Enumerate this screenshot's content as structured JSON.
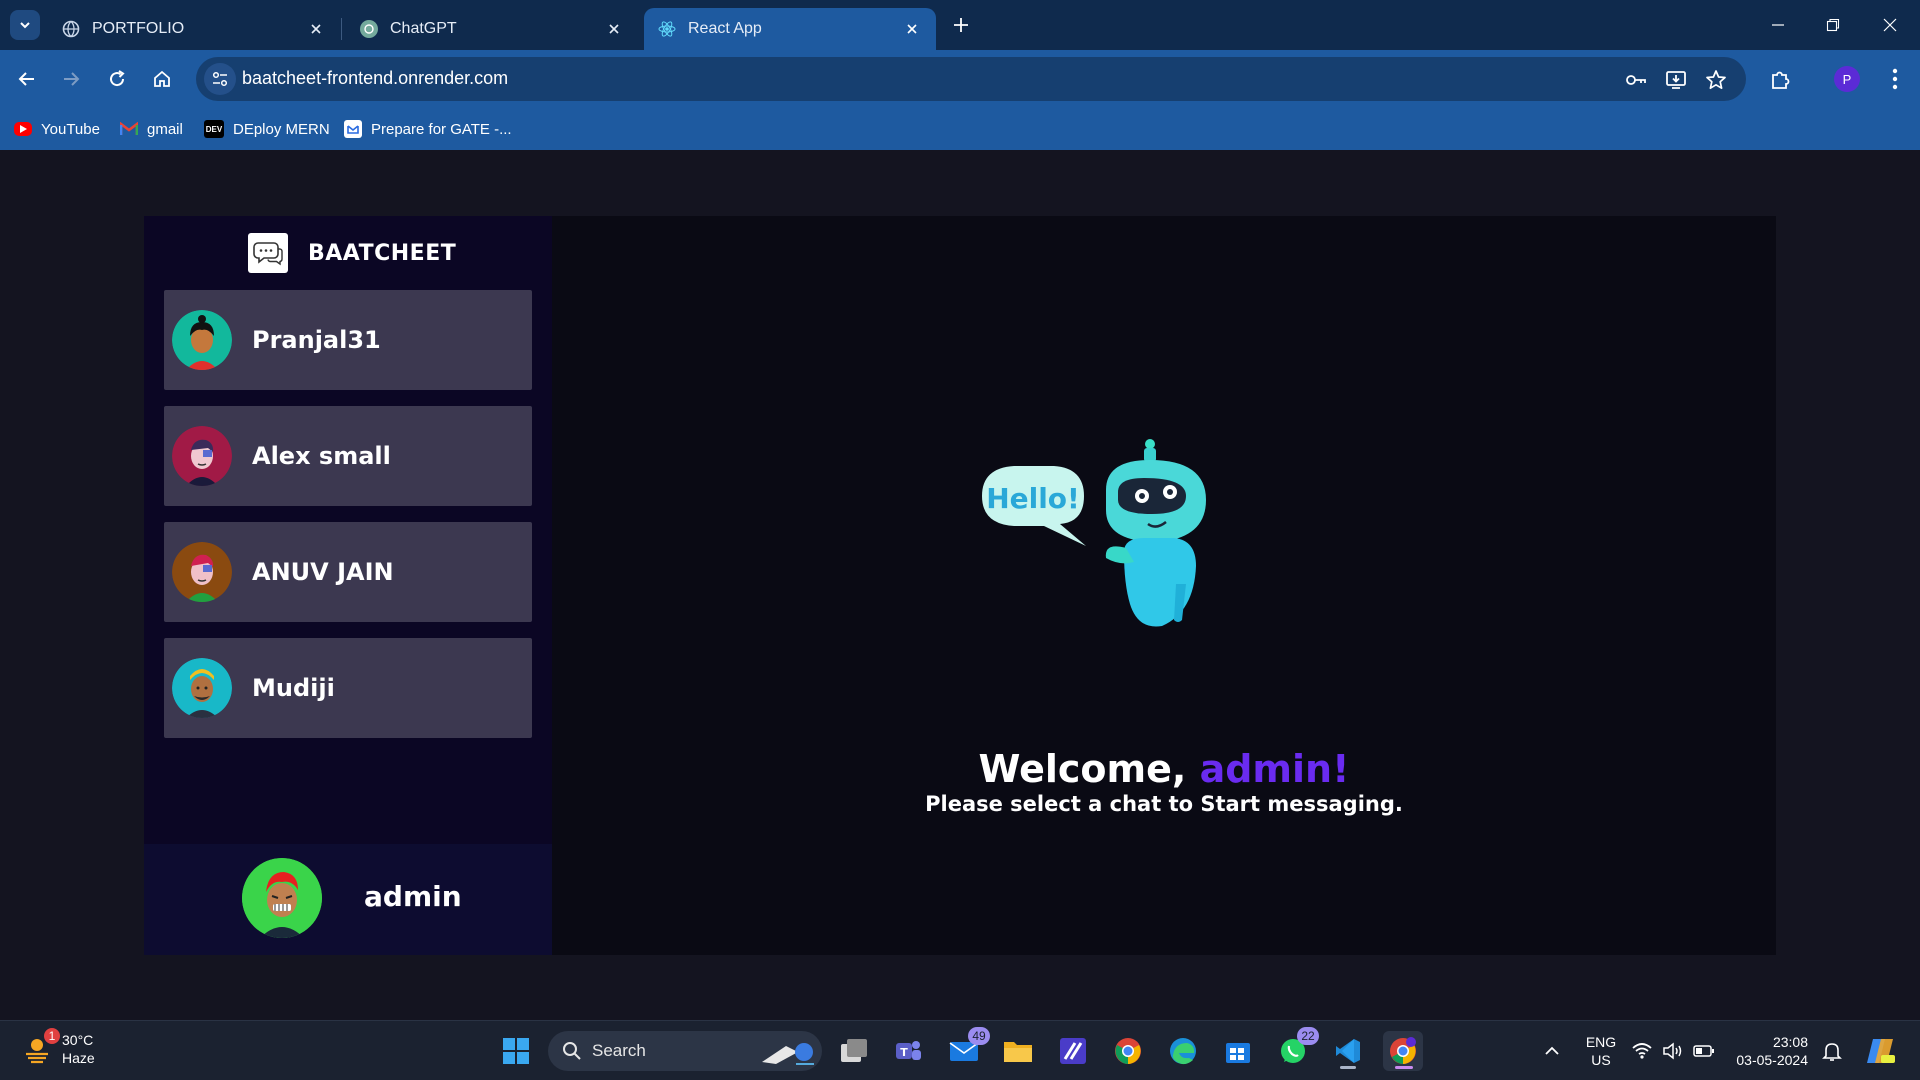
{
  "tabs": [
    {
      "title": "PORTFOLIO"
    },
    {
      "title": "ChatGPT"
    },
    {
      "title": "React App"
    }
  ],
  "address_bar": {
    "url": "baatcheet-frontend.onrender.com"
  },
  "profile_initial": "P",
  "bookmarks": [
    {
      "label": "YouTube"
    },
    {
      "label": "gmail"
    },
    {
      "label": "DEploy MERN"
    },
    {
      "label": "Prepare for GATE -..."
    }
  ],
  "app": {
    "brand": "BAATCHEET",
    "chats": [
      {
        "name": "Pranjal31"
      },
      {
        "name": "Alex small"
      },
      {
        "name": "ANUV JAIN"
      },
      {
        "name": "Mudiji"
      }
    ],
    "current_user": "admin",
    "welcome_prefix": "Welcome, ",
    "welcome_name": "admin!",
    "subtitle": "Please select a chat to Start messaging.",
    "hello_bubble": "Hello!"
  },
  "taskbar": {
    "weather": {
      "temp": "30°C",
      "condition": "Haze",
      "alert_count": "1"
    },
    "search_label": "Search",
    "mail_badge": "49",
    "whatsapp_badge": "22",
    "language": "ENG",
    "region": "US",
    "time": "23:08",
    "date": "03-05-2024"
  }
}
